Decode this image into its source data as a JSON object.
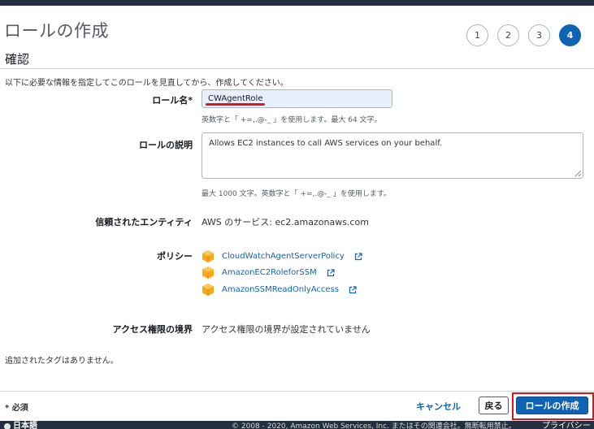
{
  "page_title": "ロールの作成",
  "steps": [
    "1",
    "2",
    "3",
    "4"
  ],
  "section_title": "確認",
  "intro": "以下に必要な情報を指定してこのロールを見直してから、作成してください。",
  "role_name": {
    "label": "ロール名*",
    "value": "CWAgentRole",
    "hint": "英数字と「 +=,.@-_ 」を使用します。最大 64 文字。"
  },
  "role_description": {
    "label": "ロールの説明",
    "value": "Allows EC2 instances to call AWS services on your behalf.",
    "hint": "最大 1000 文字。英数字と「 +=,.@-_ 」を使用します。"
  },
  "trusted_entity": {
    "label": "信頼されたエンティティ",
    "value": "AWS のサービス: ec2.amazonaws.com"
  },
  "policies": {
    "label": "ポリシー",
    "items": [
      {
        "name": "CloudWatchAgentServerPolicy",
        "icon": "policy-box-icon"
      },
      {
        "name": "AmazonEC2RoleforSSM",
        "icon": "policy-box-icon"
      },
      {
        "name": "AmazonSSMReadOnlyAccess",
        "icon": "policy-box-icon"
      }
    ]
  },
  "permissions_boundary": {
    "label": "アクセス権限の境界",
    "value": "アクセス権限の境界が設定されていません"
  },
  "tags_note": "追加されたタグはありません。",
  "required_note": "* 必須",
  "buttons": {
    "cancel": "キャンセル",
    "back": "戻る",
    "create": "ロールの作成"
  },
  "bottom_bar": {
    "language": "日本語",
    "copyright": "© 2008 - 2020, Amazon Web Services, Inc. またはその関連会社。無断転用禁止。",
    "privacy": "プライバシー"
  },
  "colors": {
    "accent": "#0f63b5",
    "highlight": "#e0141e",
    "policy_icon": "#f7a81b",
    "nav_bar": "#232f3e"
  }
}
